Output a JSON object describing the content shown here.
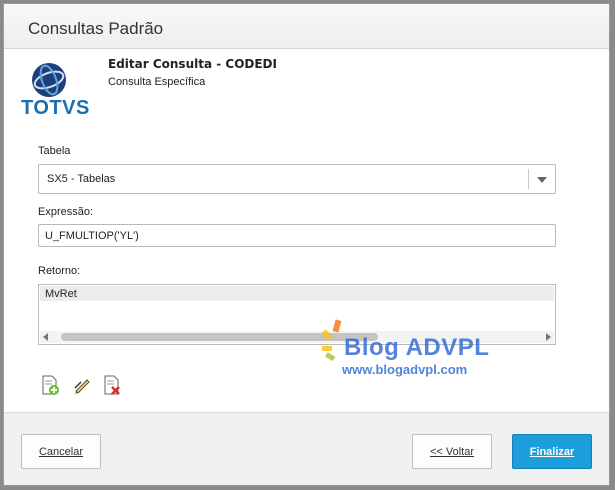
{
  "window": {
    "title": "Consultas Padrão"
  },
  "brand": {
    "logo_text": "TOTVS"
  },
  "header": {
    "title": "Editar Consulta - CODEDI",
    "subtitle": "Consulta Específica"
  },
  "form": {
    "tabela": {
      "label": "Tabela",
      "value": "SX5 - Tabelas"
    },
    "expressao": {
      "label": "Expressão:",
      "value": "U_FMULTIOP('YL')"
    },
    "retorno": {
      "label": "Retorno:",
      "rows": [
        "MvRet"
      ]
    }
  },
  "toolbar": {
    "icons": [
      "add-doc-icon",
      "edit-pencil-icon",
      "delete-doc-icon"
    ]
  },
  "watermark": {
    "line1": "Blog ADVPL",
    "line2": "www.blogadvpl.com"
  },
  "footer": {
    "cancel_label": "Cancelar",
    "back_label": "<< Voltar",
    "finish_label": "Finalizar"
  },
  "colors": {
    "primary_button": "#1b9ed9",
    "brand_blue": "#1a6fb0"
  }
}
